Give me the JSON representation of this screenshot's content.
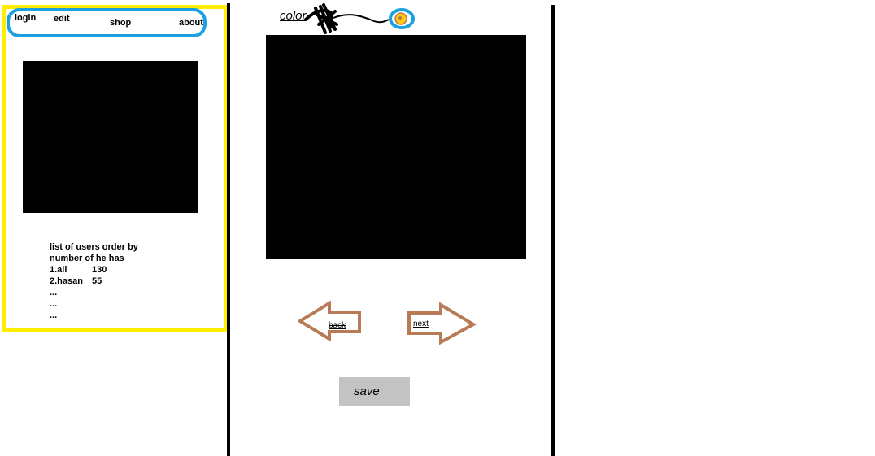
{
  "nav": {
    "login": "login",
    "edit": "edit",
    "shop": "shop",
    "about": "about"
  },
  "user_list": {
    "title_line1": "list of users order by",
    "title_line2": "number of he has",
    "rows": [
      {
        "name": "1.ali",
        "count": "130"
      },
      {
        "name": "2.hasan",
        "count": "55"
      }
    ],
    "ellipses": [
      "...",
      "...",
      "..."
    ]
  },
  "editor": {
    "color_label": "color",
    "back_label": "back",
    "next_label": "next",
    "save_label": "save"
  },
  "colors": {
    "left_border": "#ffee00",
    "nav_border": "#1aa2e0",
    "arrow": "#b97a57",
    "save_bg": "#c3c3c3",
    "picker_ring": "#1aa2e0",
    "picker_fill": "#ffc90e"
  }
}
